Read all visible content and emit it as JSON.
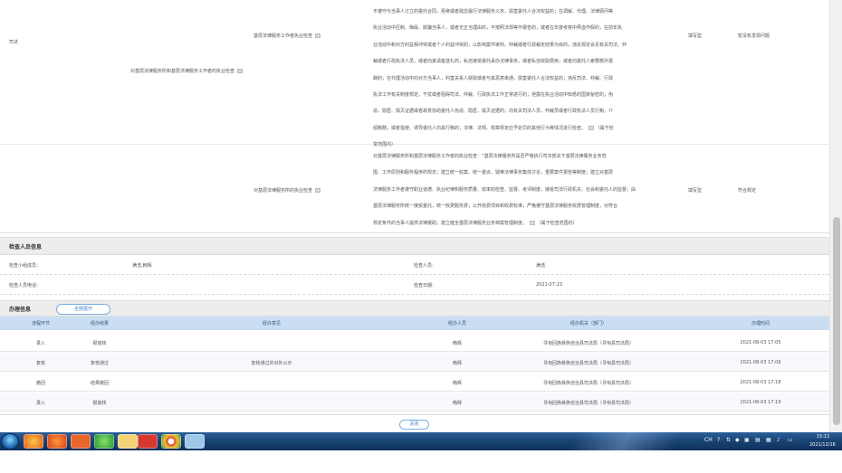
{
  "items": {
    "category_label": "司法",
    "group_label": "对基层法律服务所和基层法律服务工作者的执业检查",
    "rows": [
      {
        "item": "基层法律服务工作者执业检查",
        "description_lines": [
          "不遵守与当事人订立的委托合同，拒绝或者疏怠履行法律服务义务，损害委托人合法权益的；在调解、代理、法律顾问等",
          "执业活动中压制、侮辱、欺骗当事人，或者无正当理由的，不按照法规等作报告的，或者在年度考核中弄虚作假的，在前年执",
          "业活动中和对方利益相冲突或者个人利益冲突的，以影响案件审判、仲裁或者行政裁定结果为目的，违反规定会见有关司法、仲",
          "裁或者行政执法人员，或者向其请客送礼的，私自接受委托承办法律事务，或者私自收取费用，或者向委托人索要额外报",
          "酬的；在代理活动中向对方当事人，利害关系人获取或者与其恶意串通，损害委托人合法权益的；违反司法、仲裁、行政",
          "执法工作有关制度规定，干扰或者阻碍司法、仲裁、行政执法工作正常进行的；泄露在执业活动中知悉的国家秘密的；伪",
          "造、隐匿、毁灭证据或者故意协助委托人伪造、隐匿、毁灭证据的；向有关司法人员、仲裁员或者行政执法人员行贿，介",
          "绍贿赂，或者指使、诱导委托人向其行贿的；法律、法规、规章规定应予处罚的其他行为等情况进行检查。",
          "变范围内）"
        ],
        "trailing_note": "（属于检",
        "check_type": "填写型",
        "result": "暂没有发现问题"
      },
      {
        "item": "对基层法律服务所的执业检查",
        "description_lines": [
          "对基层法律服务所和基层法律服务工作者的执业检查：“基层法律服务所是否严格执行司法部关于基层法律服务业务范",
          "围、工作原则和服务程序的规定；建立统一收案、统一委派、疑难法律事务集体讨论，重要案件报告等制度；建立对基层",
          "法律服务工作者遵守职业道德、执业纪律和服务质量、效率的检查、监督、考评制度，接受司法行政机关、社会和委托人的监督；由",
          "基层法律服务所统一接受委托，统一收费服务费；公开收费项目和收费标准；严格遵守基层法律服务收费管理制度，对符合",
          "规定条件的当事人提供法律援助；建立健全基层法律服务业务档案管理制度。"
        ],
        "trailing_note": "（属于检查范围内）",
        "check_type": "填写型",
        "result": "符合规定"
      }
    ]
  },
  "inspector_section": {
    "title": "检查人员信息",
    "team_label": "检查小组成员：",
    "team_value": "满浩,韩辉",
    "inspector_label": "检查人员：",
    "inspector_value": "满浩",
    "phone_label": "检查人员电话：",
    "phone_value": "",
    "date_label": "检查日期：",
    "date_value": "2021-07-23"
  },
  "handling_section": {
    "title": "办理信息",
    "expand_button": "全部展开",
    "columns": [
      "流程环节",
      "经办结果",
      "经办意见",
      "经办人员",
      "经办机关（部门）",
      "办理时间"
    ],
    "rows": [
      [
        "录入",
        "报窗核",
        "",
        "韩辉",
        "寻甸回族彝族自治县司法局（寻甸县司法局）",
        "2021-08-03 17:05"
      ],
      [
        "复核",
        "复核通过",
        "复核通过并对外公示",
        "韩辉",
        "寻甸回族彝族自治县司法局（寻甸县司法局）",
        "2021-08-03 17:06"
      ],
      [
        "撤回",
        "结果撤回",
        "",
        "韩辉",
        "寻甸回族彝族自治县司法局（寻甸县司法局）",
        "2021-08-03 17:18"
      ],
      [
        "录入",
        "报窗核",
        "",
        "韩辉",
        "寻甸回族彝族自治县司法局（寻甸县司法局）",
        "2021-08-03 17:19"
      ]
    ]
  },
  "close_button": "关闭",
  "taskbar": {
    "apps": [
      "ie-icon",
      "firefox-icon",
      "presentation-icon",
      "chat-icon",
      "folder-icon",
      "pdf-icon",
      "chrome-icon",
      "paint-icon"
    ],
    "tray_lang": "CH",
    "clock_time": "15:11",
    "clock_date": "2021/12/16"
  },
  "colors": {
    "accent": "#3c85d0",
    "header_bg": "#c9def2",
    "taskbar": "#17406f"
  }
}
